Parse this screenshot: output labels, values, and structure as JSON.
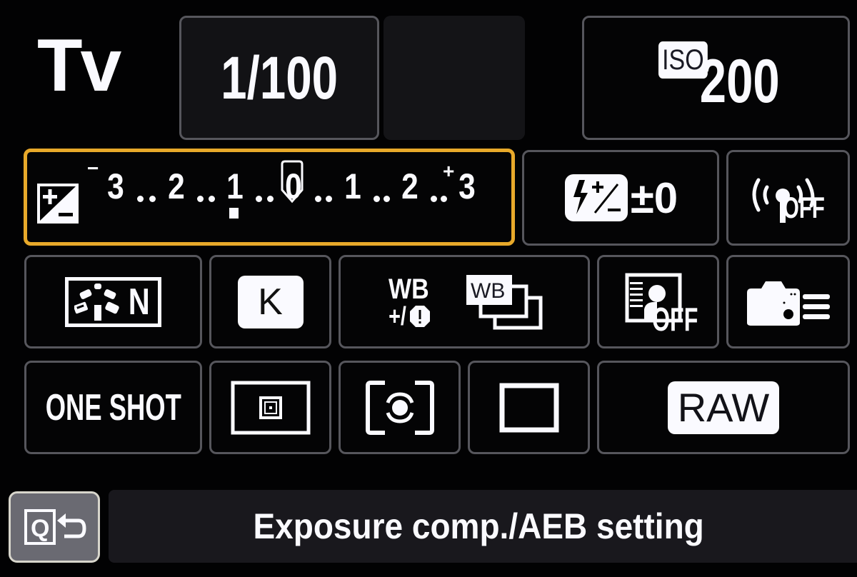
{
  "screen": "Quick Control Screen",
  "shooting_mode": "Tv",
  "shutter_speed": "1/100",
  "aperture": "",
  "iso": {
    "badge": "ISO",
    "value": "200"
  },
  "exposure_comp": {
    "label": "Exposure compensation / AEB",
    "scale_labels": [
      "3",
      "2",
      "1",
      "0",
      "1",
      "2",
      "3"
    ],
    "minus_sign": "−",
    "plus_sign": "+",
    "current_value_ev": -1,
    "selected": true,
    "accent_color": "#e8a92a"
  },
  "flash_exposure_comp": {
    "icon": "flash-exposure-comp-icon",
    "value": "±0"
  },
  "wireless": {
    "icon": "wireless-off-icon",
    "state": "OFF"
  },
  "picture_style": {
    "icon": "picture-style-neutral-icon",
    "value": "N"
  },
  "white_balance": {
    "icon": "wb-kelvin-icon",
    "value": "K"
  },
  "wb_shift": {
    "line1": "WB",
    "line2": "+/"
  },
  "wb_bracket": {
    "label": "WB"
  },
  "face_detect": {
    "icon": "face-detect-off-icon",
    "state": "OFF"
  },
  "custom_controls": {
    "icon": "camera-custom-controls-icon"
  },
  "af_operation": "ONE SHOT",
  "af_method": {
    "icon": "spot-af-icon"
  },
  "metering_mode": {
    "icon": "evaluative-metering-icon"
  },
  "drive_mode": {
    "icon": "single-shot-drive-icon"
  },
  "image_quality": "RAW",
  "back_button": {
    "icon": "q-return-icon",
    "label": "Q"
  },
  "help_text": "Exposure comp./AEB setting"
}
